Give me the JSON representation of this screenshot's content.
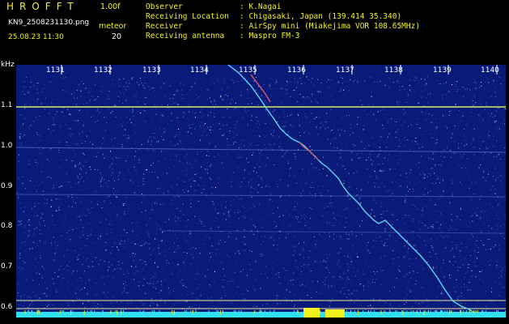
{
  "header": {
    "app_title": "HROFFT",
    "version": "1.00f",
    "filename": "KN9_2508231130.png",
    "meteor_label": "meteor",
    "datetime": "25.08.23 11:30",
    "meteor_count": "20"
  },
  "info": {
    "observer_label": "Observer",
    "observer_value": ": K.Nagai",
    "location_label": "Receiving Location",
    "location_value": ": Chigasaki, Japan (139.414 35.340)",
    "receiver_label": "Receiver",
    "receiver_value": ": AirSpy mini (Miakejima VOR 108.65MHz)",
    "antenna_label": "Receiving antenna",
    "antenna_value": ": Maspro FM-3"
  },
  "axis": {
    "y_unit_label": "kHz",
    "y_labels": [
      "1.1",
      "1.0",
      "0.9",
      "0.8",
      "0.7",
      "0.6"
    ],
    "x_labels": [
      "1131",
      "1132",
      "1133",
      "1134",
      "1135",
      "1136",
      "1137",
      "1138",
      "1139",
      "1140"
    ]
  },
  "colors": {
    "background": "#000000",
    "spectrogram_bg": "#0a1a78",
    "carrier_line": "#d8f060",
    "meteor_trace": "#5ad8f0",
    "grid_line": "#e8e8a0",
    "bottom_strip": "#30e0f0",
    "burst": "#f2f21e"
  }
}
